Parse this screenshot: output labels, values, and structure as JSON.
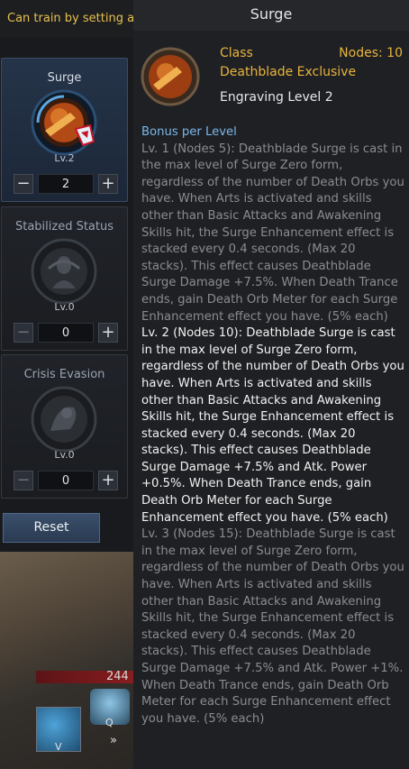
{
  "banner": "Can train by setting a",
  "slots": [
    {
      "name": "Surge",
      "level": "Lv.2",
      "value": "2"
    },
    {
      "name": "Stabilized Status",
      "level": "Lv.0",
      "value": "0"
    },
    {
      "name": "Crisis Evasion",
      "level": "Lv.0",
      "value": "0"
    }
  ],
  "reset_label": "Reset",
  "hud": {
    "hp_text": "244",
    "skill_q_key": "Q",
    "skill_v_key": "V"
  },
  "tooltip": {
    "title": "Surge",
    "class_label": "Class",
    "nodes": "Nodes: 10",
    "exclusive": "Deathblade Exclusive",
    "engraving": "Engraving Level 2",
    "bonus_header": "Bonus per Level",
    "levels": [
      "Lv. 1 (Nodes 5): Deathblade Surge is cast in the max level of Surge Zero form, regardless of the number of Death Orbs you have. When Arts is activated and skills other than Basic Attacks and Awakening Skills hit, the Surge Enhancement effect is stacked every 0.4 seconds. (Max 20 stacks). This effect causes Deathblade Surge Damage +7.5%. When Death Trance ends, gain Death Orb Meter for each Surge Enhancement effect you have. (5% each)",
      "Lv. 2 (Nodes 10): Deathblade Surge is cast in the max level of Surge Zero form, regardless of the number of Death Orbs you have. When Arts is activated and skills other than Basic Attacks and Awakening Skills hit, the Surge Enhancement effect is stacked every 0.4 seconds. (Max 20 stacks). This effect causes Deathblade Surge Damage +7.5% and Atk. Power +0.5%. When Death Trance ends, gain Death Orb Meter for each Surge Enhancement effect you have. (5% each)",
      "Lv. 3 (Nodes 15): Deathblade Surge is cast in the max level of Surge Zero form, regardless of the number of Death Orbs you have. When Arts is activated and skills other than Basic Attacks and Awakening Skills hit, the Surge Enhancement effect is stacked every 0.4 seconds. (Max 20 stacks). This effect causes Deathblade Surge Damage +7.5% and Atk. Power +1%. When Death Trance ends, gain Death Orb Meter for each Surge Enhancement effect you have. (5% each)"
    ]
  },
  "colors": {
    "accent_gold": "#e8b43c",
    "bonus_blue": "#7ab7e8",
    "active_slot": "#253449"
  }
}
